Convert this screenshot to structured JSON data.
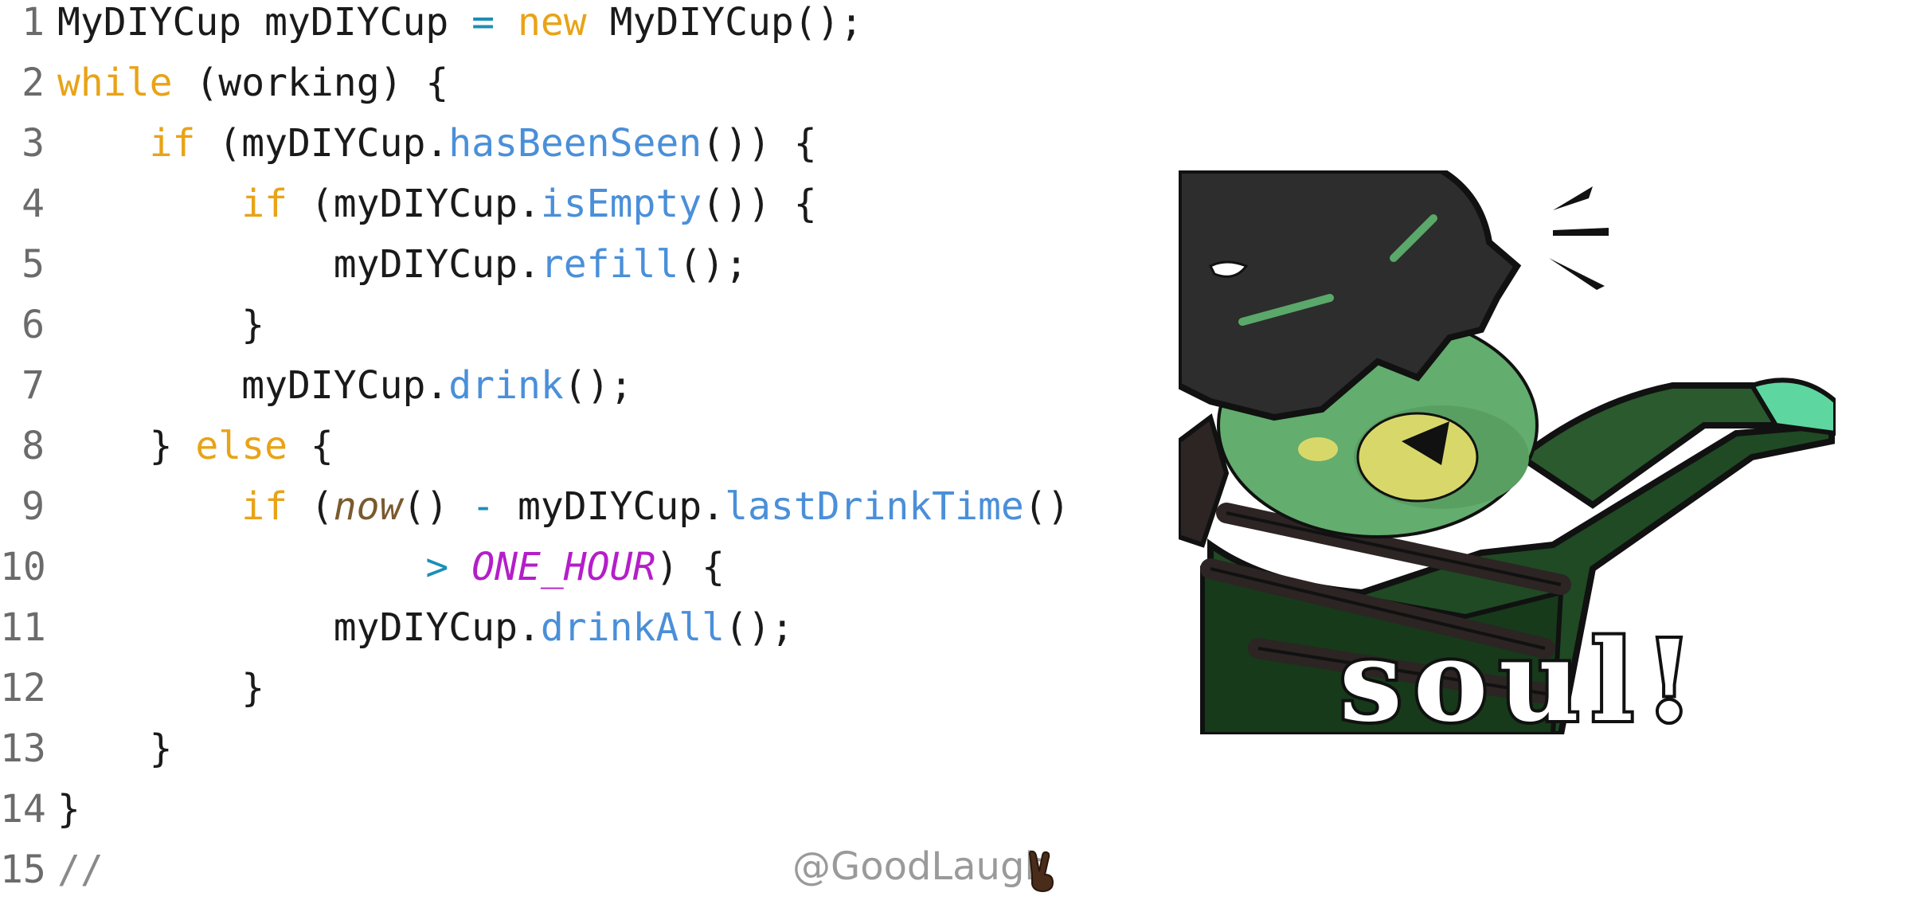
{
  "code_lines": [
    {
      "n": "1",
      "parts": [
        [
          "",
          "MyDIYCup myDIYCup "
        ],
        [
          "op",
          "="
        ],
        [
          "",
          " "
        ],
        [
          "kw",
          "new"
        ],
        [
          "",
          " MyDIYCup();"
        ]
      ]
    },
    {
      "n": "2",
      "parts": [
        [
          "kw",
          "while"
        ],
        [
          "",
          " (working) {"
        ]
      ]
    },
    {
      "n": "3",
      "parts": [
        [
          "",
          "    "
        ],
        [
          "kw",
          "if"
        ],
        [
          "",
          " (myDIYCup."
        ],
        [
          "fn",
          "hasBeenSeen"
        ],
        [
          "",
          "()) {"
        ]
      ]
    },
    {
      "n": "4",
      "parts": [
        [
          "",
          "        "
        ],
        [
          "kw",
          "if"
        ],
        [
          "",
          " (myDIYCup."
        ],
        [
          "fn",
          "isEmpty"
        ],
        [
          "",
          "()) {"
        ]
      ]
    },
    {
      "n": "5",
      "parts": [
        [
          "",
          "            myDIYCup."
        ],
        [
          "fn",
          "refill"
        ],
        [
          "",
          "();"
        ]
      ]
    },
    {
      "n": "6",
      "parts": [
        [
          "",
          "        }"
        ]
      ]
    },
    {
      "n": "7",
      "parts": [
        [
          "",
          "        myDIYCup."
        ],
        [
          "fn",
          "drink"
        ],
        [
          "",
          "();"
        ]
      ]
    },
    {
      "n": "8",
      "parts": [
        [
          "",
          "    } "
        ],
        [
          "kw",
          "else"
        ],
        [
          "",
          " {"
        ]
      ]
    },
    {
      "n": "9",
      "parts": [
        [
          "",
          "        "
        ],
        [
          "kw",
          "if"
        ],
        [
          "",
          " ("
        ],
        [
          "itl",
          "now"
        ],
        [
          "",
          "() "
        ],
        [
          "op",
          "-"
        ],
        [
          "",
          " myDIYCup."
        ],
        [
          "fn",
          "lastDrinkTime"
        ],
        [
          "",
          "()"
        ]
      ]
    },
    {
      "n": "10",
      "parts": [
        [
          "",
          "                "
        ],
        [
          "op",
          ">"
        ],
        [
          "",
          " "
        ],
        [
          "const",
          "ONE_HOUR"
        ],
        [
          "",
          ") {"
        ]
      ]
    },
    {
      "n": "11",
      "parts": [
        [
          "",
          "            myDIYCup."
        ],
        [
          "fn",
          "drinkAll"
        ],
        [
          "",
          "();"
        ]
      ]
    },
    {
      "n": "12",
      "parts": [
        [
          "",
          "        }"
        ]
      ]
    },
    {
      "n": "13",
      "parts": [
        [
          "",
          "    }"
        ]
      ]
    },
    {
      "n": "14",
      "parts": [
        [
          "",
          "}"
        ]
      ]
    },
    {
      "n": "15",
      "parts": [
        [
          "cm",
          "//"
        ]
      ]
    }
  ],
  "watermark": {
    "handle": "@GoodLaugh",
    "emoji_icon": "victory-hand-icon"
  },
  "sticker": {
    "caption": "soul!",
    "icon": "character-sticker-icon"
  },
  "colors": {
    "keyword": "#e8a317",
    "method": "#4a8fd9",
    "operator": "#1b8fb5",
    "constant": "#b41ec9",
    "italic_fn": "#7a5a2e",
    "line_number": "#6b6b6b"
  }
}
